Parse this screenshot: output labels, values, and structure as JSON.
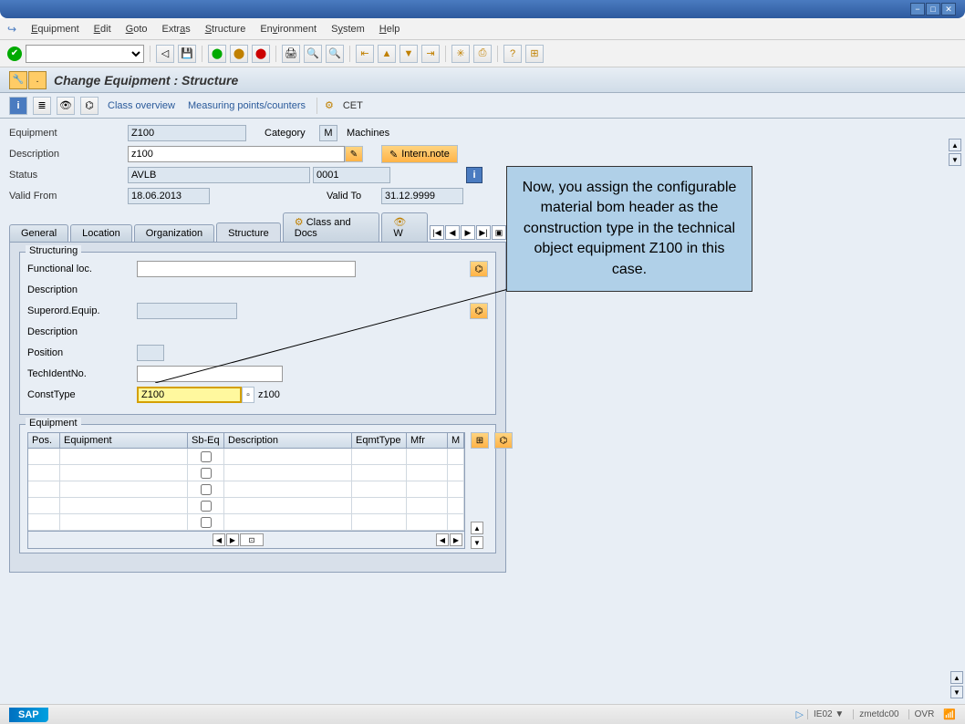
{
  "window": {
    "min": "−",
    "max": "□",
    "close": "✕"
  },
  "menu": {
    "app_icon": "↪",
    "items": [
      "Equipment",
      "Edit",
      "Goto",
      "Extras",
      "Structure",
      "Environment",
      "System",
      "Help"
    ]
  },
  "page": {
    "title": "Change Equipment : Structure"
  },
  "subtoolbar": {
    "class_overview": "Class overview",
    "measuring": "Measuring points/counters",
    "cet": "CET"
  },
  "header": {
    "equipment_label": "Equipment",
    "equipment_value": "Z100",
    "category_label": "Category",
    "category_code": "M",
    "category_text": "Machines",
    "description_label": "Description",
    "description_value": "z100",
    "intern_note": "Intern.note",
    "status_label": "Status",
    "status_value": "AVLB",
    "status_code": "0001",
    "valid_from_label": "Valid From",
    "valid_from_value": "18.06.2013",
    "valid_to_label": "Valid To",
    "valid_to_value": "31.12.9999"
  },
  "tabs": {
    "general": "General",
    "location": "Location",
    "organization": "Organization",
    "structure": "Structure",
    "class_docs": "Class and Docs",
    "w": "W"
  },
  "structuring": {
    "group_title": "Structuring",
    "func_loc_label": "Functional loc.",
    "desc1_label": "Description",
    "superord_label": "Superord.Equip.",
    "desc2_label": "Description",
    "position_label": "Position",
    "tech_ident_label": "TechIdentNo.",
    "const_type_label": "ConstType",
    "const_type_value": "Z100",
    "const_type_text": "z100"
  },
  "equipment_table": {
    "group_title": "Equipment",
    "cols": {
      "pos": "Pos.",
      "equipment": "Equipment",
      "sbeq": "Sb-Eq",
      "description": "Description",
      "eqmttype": "EqmtType",
      "mfr": "Mfr",
      "m": "M"
    }
  },
  "callout": {
    "text": "Now, you assign the configurable material bom header as the construction type in the technical object equipment Z100 in this case."
  },
  "statusbar": {
    "sap": "SAP",
    "tcode": "IE02",
    "sys": "zmetdc00",
    "ovr": "OVR"
  }
}
